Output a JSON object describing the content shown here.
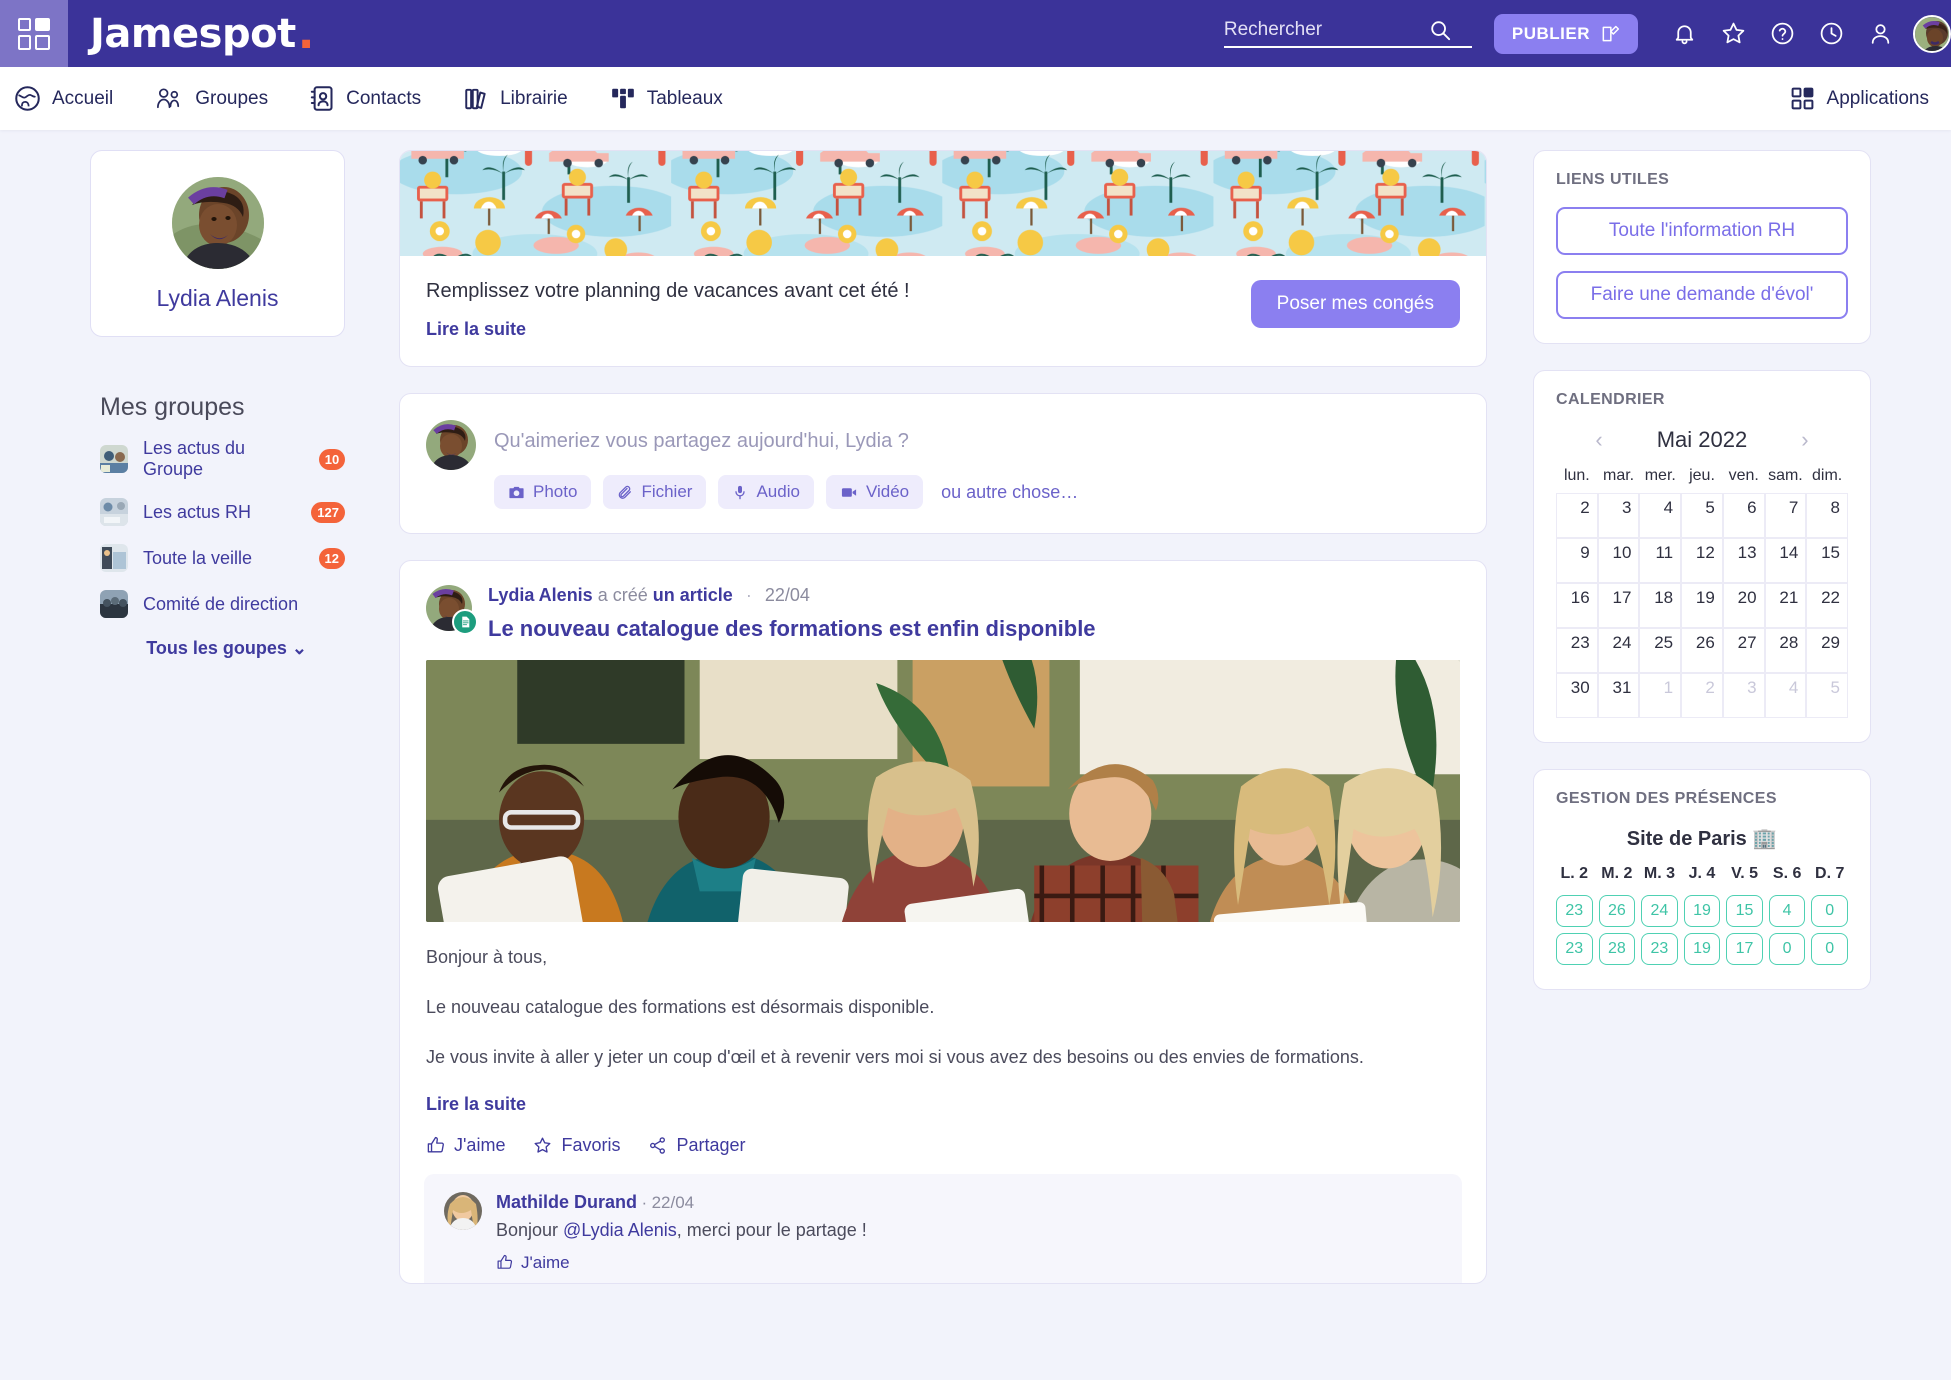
{
  "brand": {
    "name": "Jamespot",
    "dot": "."
  },
  "header": {
    "search_placeholder": "Rechercher",
    "search_value": "",
    "publish_label": "PUBLIER",
    "icons": [
      "bell-icon",
      "star-icon",
      "help-icon",
      "clock-icon",
      "person-icon"
    ]
  },
  "nav": {
    "items": [
      {
        "label": "Accueil",
        "icon": "globe-icon"
      },
      {
        "label": "Groupes",
        "icon": "people-icon"
      },
      {
        "label": "Contacts",
        "icon": "address-book-icon"
      },
      {
        "label": "Librairie",
        "icon": "books-icon"
      },
      {
        "label": "Tableaux",
        "icon": "boards-icon"
      }
    ],
    "applications": "Applications"
  },
  "profile": {
    "name": "Lydia Alenis"
  },
  "groups": {
    "title": "Mes groupes",
    "items": [
      {
        "name": "Les actus du Groupe",
        "badge": "10"
      },
      {
        "name": "Les actus RH",
        "badge": "127"
      },
      {
        "name": "Toute la veille",
        "badge": "12"
      },
      {
        "name": "Comité de direction",
        "badge": ""
      }
    ],
    "all_label": "Tous les goupes"
  },
  "banner": {
    "title": "Remplissez votre planning de vacances avant cet été !",
    "read_more": "Lire la suite",
    "button": "Poser mes congés"
  },
  "composer": {
    "placeholder": "Qu'aimeriez vous partagez aujourd'hui, Lydia ?",
    "chips": [
      {
        "label": "Photo",
        "icon": "camera-icon"
      },
      {
        "label": "Fichier",
        "icon": "paperclip-icon"
      },
      {
        "label": "Audio",
        "icon": "microphone-icon"
      },
      {
        "label": "Vidéo",
        "icon": "video-icon"
      }
    ],
    "more": "ou autre chose…"
  },
  "post": {
    "author": "Lydia Alenis",
    "action": "a créé",
    "object": "un article",
    "separator": "·",
    "date": "22/04",
    "title": "Le nouveau catalogue des formations est enfin disponible",
    "paragraphs": [
      "Bonjour à tous,",
      "Le nouveau catalogue des formations est désormais disponible.",
      "Je vous invite à aller y jeter un coup d'œil et à revenir vers moi si vous avez des besoins ou des envies de formations."
    ],
    "read_more": "Lire la suite",
    "actions": [
      {
        "label": "J'aime",
        "icon": "thumbs-up-icon"
      },
      {
        "label": "Favoris",
        "icon": "star-icon"
      },
      {
        "label": "Partager",
        "icon": "share-icon"
      }
    ],
    "comment": {
      "author": "Mathilde Durand",
      "separator": "·",
      "date": "22/04",
      "text_before": "Bonjour ",
      "mention": "@Lydia Alenis",
      "text_after": ", merci pour le partage !",
      "like_label": "J'aime"
    }
  },
  "links_widget": {
    "title": "LIENS UTILES",
    "buttons": [
      "Toute l'information RH",
      "Faire une demande d'évol'"
    ]
  },
  "calendar": {
    "title": "CALENDRIER",
    "month": "Mai 2022",
    "prev": "‹",
    "next": "›",
    "dow": [
      "lun.",
      "mar.",
      "mer.",
      "jeu.",
      "ven.",
      "sam.",
      "dim."
    ],
    "weeks": [
      [
        {
          "d": "2"
        },
        {
          "d": "3"
        },
        {
          "d": "4"
        },
        {
          "d": "5"
        },
        {
          "d": "6"
        },
        {
          "d": "7"
        },
        {
          "d": "8"
        }
      ],
      [
        {
          "d": "9"
        },
        {
          "d": "10"
        },
        {
          "d": "11"
        },
        {
          "d": "12"
        },
        {
          "d": "13"
        },
        {
          "d": "14"
        },
        {
          "d": "15"
        }
      ],
      [
        {
          "d": "16"
        },
        {
          "d": "17"
        },
        {
          "d": "18"
        },
        {
          "d": "19"
        },
        {
          "d": "20"
        },
        {
          "d": "21"
        },
        {
          "d": "22"
        }
      ],
      [
        {
          "d": "23"
        },
        {
          "d": "24"
        },
        {
          "d": "25"
        },
        {
          "d": "26"
        },
        {
          "d": "27"
        },
        {
          "d": "28"
        },
        {
          "d": "29"
        }
      ],
      [
        {
          "d": "30"
        },
        {
          "d": "31"
        },
        {
          "d": "1",
          "muted": true
        },
        {
          "d": "2",
          "muted": true
        },
        {
          "d": "3",
          "muted": true
        },
        {
          "d": "4",
          "muted": true
        },
        {
          "d": "5",
          "muted": true
        }
      ]
    ]
  },
  "presence": {
    "title": "GESTION DES PRÉSENCES",
    "site": "Site de Paris 🏢",
    "dow": [
      "L. 2",
      "M. 2",
      "M. 3",
      "J. 4",
      "V. 5",
      "S. 6",
      "D. 7"
    ],
    "rows": [
      [
        "23",
        "26",
        "24",
        "19",
        "15",
        "4",
        "0"
      ],
      [
        "23",
        "28",
        "23",
        "19",
        "17",
        "0",
        "0"
      ]
    ]
  },
  "colors": {
    "header_purple": "#3b3399",
    "accent_purple": "#8b7ff0",
    "link_purple": "#3f3a9e",
    "badge_orange": "#f4633a",
    "teal": "#4fd1b3",
    "page_bg": "#f2f3fb"
  }
}
